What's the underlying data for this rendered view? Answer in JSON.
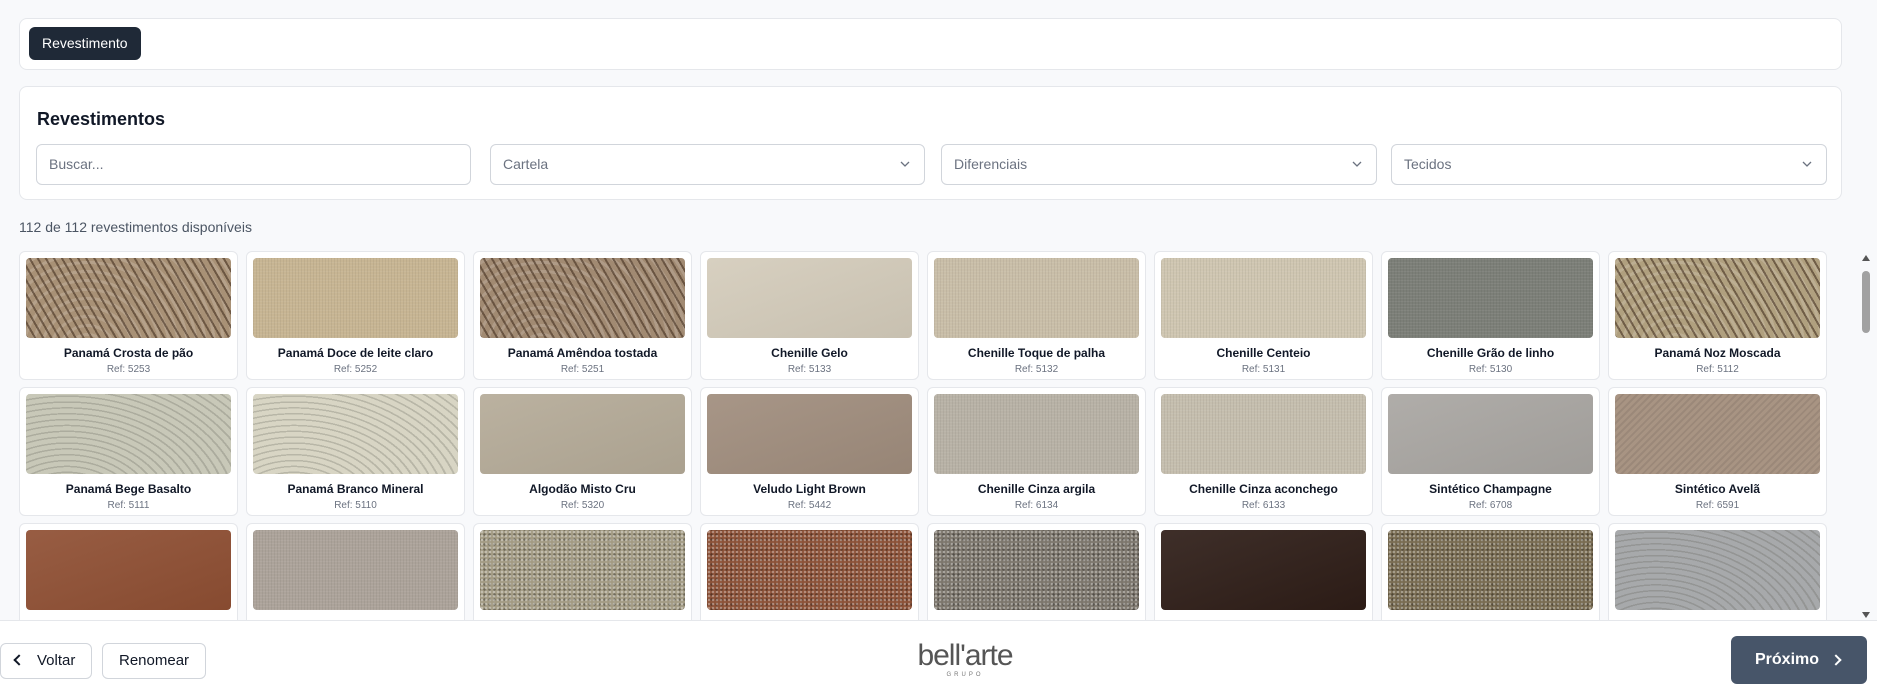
{
  "tabs": {
    "active_label": "Revestimento"
  },
  "filters": {
    "title": "Revestimentos",
    "search_placeholder": "Buscar...",
    "cartela": "Cartela",
    "diferenciais": "Diferenciais",
    "tecidos": "Tecidos"
  },
  "results_count": "112 de 112 revestimentos disponíveis",
  "items": [
    {
      "name": "Panamá Crosta de pão",
      "ref": "Ref: 5253",
      "color": "#a89176",
      "pattern": "wave-dark"
    },
    {
      "name": "Panamá Doce de leite claro",
      "ref": "Ref: 5252",
      "color": "#c7b593",
      "pattern": "fine"
    },
    {
      "name": "Panamá Amêndoa tostada",
      "ref": "Ref: 5251",
      "color": "#a18a72",
      "pattern": "wave-dark"
    },
    {
      "name": "Chenille Gelo",
      "ref": "Ref: 5133",
      "color": "#d4ccbb",
      "pattern": "plain"
    },
    {
      "name": "Chenille Toque de palha",
      "ref": "Ref: 5132",
      "color": "#c9bea8",
      "pattern": "fine"
    },
    {
      "name": "Chenille Centeio",
      "ref": "Ref: 5131",
      "color": "#cfc6b1",
      "pattern": "fine"
    },
    {
      "name": "Chenille Grão de linho",
      "ref": "Ref: 5130",
      "color": "#7c7f78",
      "pattern": "fine"
    },
    {
      "name": "Panamá Noz Moscada",
      "ref": "Ref: 5112",
      "color": "#b0a07f",
      "pattern": "wave-dark"
    },
    {
      "name": "Panamá Bege Basalto",
      "ref": "Ref: 5111",
      "color": "#c8c8b8",
      "pattern": "wave-light"
    },
    {
      "name": "Panamá Branco Mineral",
      "ref": "Ref: 5110",
      "color": "#d8d5c4",
      "pattern": "wave-light"
    },
    {
      "name": "Algodão Misto Cru",
      "ref": "Ref: 5320",
      "color": "#b5ab98",
      "pattern": "plain"
    },
    {
      "name": "Veludo Light Brown",
      "ref": "Ref: 5442",
      "color": "#a08d7d",
      "pattern": "plain"
    },
    {
      "name": "Chenille Cinza argila",
      "ref": "Ref: 6134",
      "color": "#b8b2a6",
      "pattern": "fine"
    },
    {
      "name": "Chenille Cinza aconchego",
      "ref": "Ref: 6133",
      "color": "#c5beae",
      "pattern": "fine"
    },
    {
      "name": "Sintético Champagne",
      "ref": "Ref: 6708",
      "color": "#a9a6a2",
      "pattern": "plain"
    },
    {
      "name": "Sintético Avelã",
      "ref": "Ref: 6591",
      "color": "#a89483",
      "pattern": "twill"
    },
    {
      "name": "",
      "ref": "",
      "color": "#8f4f33",
      "pattern": "plain"
    },
    {
      "name": "",
      "ref": "",
      "color": "#aca39a",
      "pattern": "fine"
    },
    {
      "name": "",
      "ref": "",
      "color": "#a39b84",
      "pattern": "speckle"
    },
    {
      "name": "",
      "ref": "",
      "color": "#8c5238",
      "pattern": "speckle"
    },
    {
      "name": "",
      "ref": "",
      "color": "#7d776d",
      "pattern": "speckle"
    },
    {
      "name": "",
      "ref": "",
      "color": "#2e1d17",
      "pattern": "plain"
    },
    {
      "name": "",
      "ref": "",
      "color": "#796c52",
      "pattern": "speckle"
    },
    {
      "name": "",
      "ref": "",
      "color": "#a7a9ab",
      "pattern": "wave-light"
    }
  ],
  "footer": {
    "back_label": "Voltar",
    "rename_label": "Renomear",
    "logo_text": "bell'arte",
    "logo_sub": "GRUPO",
    "next_label": "Próximo"
  },
  "colors": {
    "primary_dark": "#1f2937",
    "next_button": "#475569"
  }
}
